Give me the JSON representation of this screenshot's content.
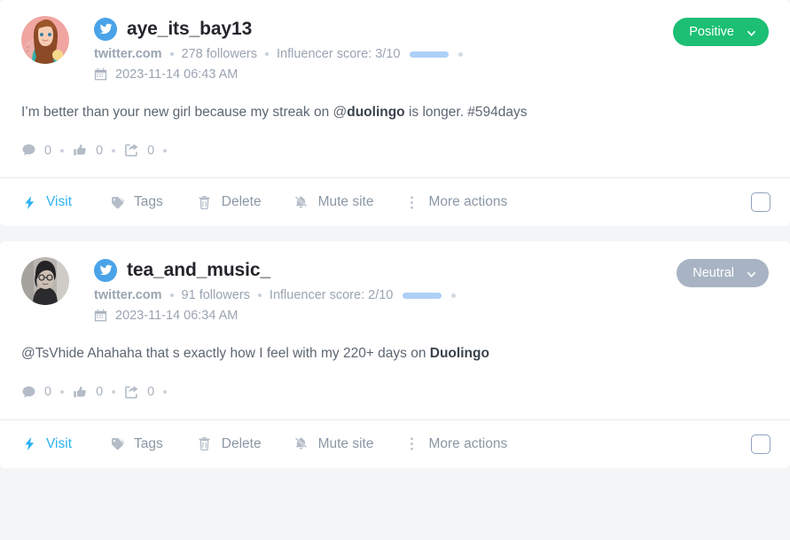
{
  "posts": [
    {
      "username": "aye_its_bay13",
      "source": "twitter.com",
      "followers": "278 followers",
      "influencer_score_label": "Influencer score: 3/10",
      "influencer_score_value": 3,
      "influencer_score_max": 10,
      "date": "2023-11-14 06:43 AM",
      "text_before": "I’m better than your new girl because my streak on @",
      "text_keyword": "duolingo",
      "text_after": " is longer. #594days",
      "sentiment": "Positive",
      "sentiment_color": "#1cbf73",
      "stats": {
        "comments": "0",
        "likes": "0",
        "shares": "0"
      },
      "avatar_type": "illustrated-female-avatar"
    },
    {
      "username": "tea_and_music_",
      "source": "twitter.com",
      "followers": "91 followers",
      "influencer_score_label": "Influencer score: 2/10",
      "influencer_score_value": 2,
      "influencer_score_max": 10,
      "date": "2023-11-14 06:34 AM",
      "text_before": "@TsVhide Ahahaha that s exactly how I feel with my 220+ days on ",
      "text_keyword": "Duolingo",
      "text_after": "",
      "sentiment": "Neutral",
      "sentiment_color": "#a8b4c4",
      "stats": {
        "comments": "0",
        "likes": "0",
        "shares": "0"
      },
      "avatar_type": "grayscale-photo-avatar"
    }
  ],
  "actions": {
    "visit": "Visit",
    "tags": "Tags",
    "delete": "Delete",
    "mute": "Mute site",
    "more": "More actions"
  },
  "icons": {
    "twitter": "twitter-bird-icon",
    "calendar": "calendar-icon",
    "comment": "comment-icon",
    "like": "thumbs-up-icon",
    "share": "share-icon",
    "visit": "lightning-bolt-icon",
    "tags": "tag-icon",
    "delete": "trash-icon",
    "mute": "bell-muted-icon",
    "more": "vertical-dots-icon",
    "chevron": "chevron-down-icon"
  },
  "colors": {
    "accent": "#2eb3f2",
    "positive": "#1cbf73",
    "neutral": "#a8b4c4",
    "score_fill": "#2e80e8",
    "score_track": "#aed0f7",
    "page_bg": "#f4f5f7"
  }
}
